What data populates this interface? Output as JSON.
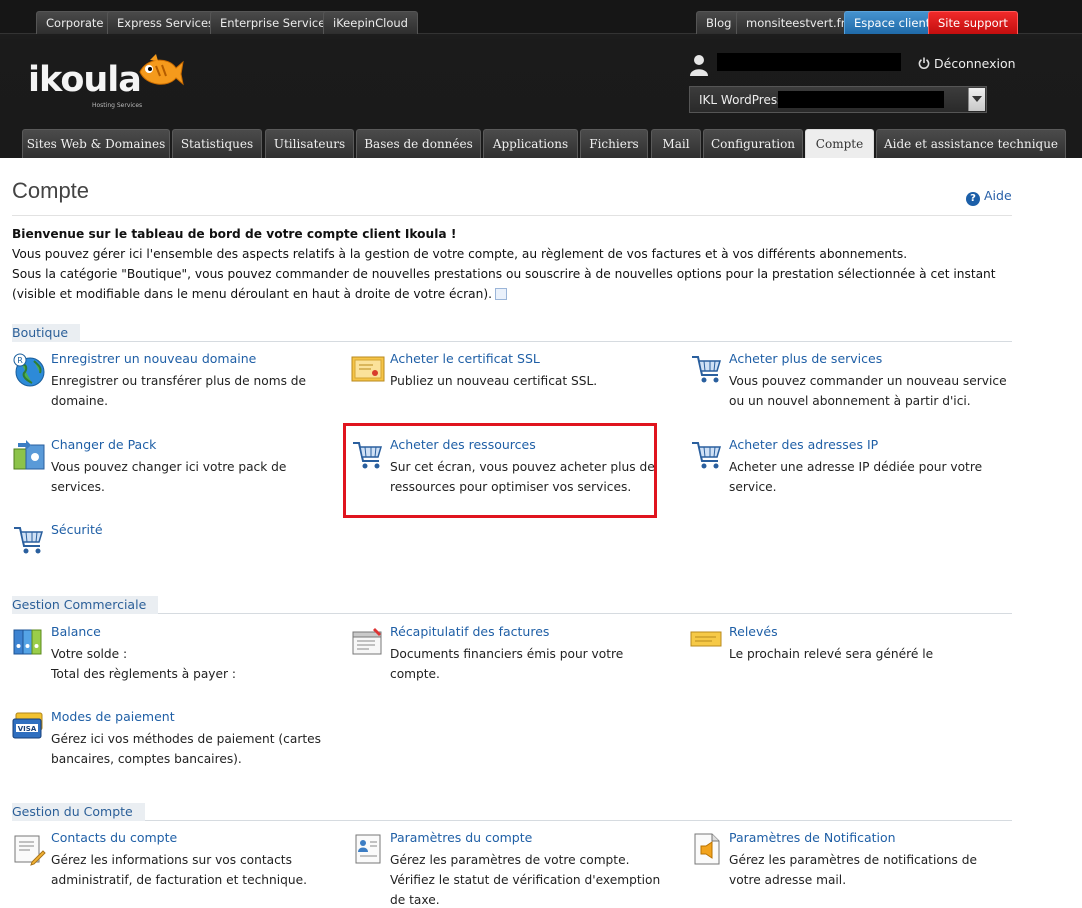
{
  "top_tabs": {
    "corporate": "Corporate",
    "express": "Express Services",
    "enterprise": "Enterprise Services",
    "ikeepin": "iKeepinCloud",
    "blog": "Blog",
    "site": "monsiteestvert.fr",
    "espace_client": "Espace client",
    "support": "Site support"
  },
  "logo": {
    "text": "ikoula",
    "tagline": "Hosting Services"
  },
  "header": {
    "logout": "Déconnexion",
    "pack_label": "IKL WordPress"
  },
  "main_tabs": [
    "Sites Web & Domaines",
    "Statistiques",
    "Utilisateurs",
    "Bases de données",
    "Applications",
    "Fichiers",
    "Mail",
    "Configuration",
    "Compte",
    "Aide et assistance technique"
  ],
  "page": {
    "title": "Compte",
    "help": "Aide",
    "intro_bold": "Bienvenue sur le tableau de bord de votre compte client Ikoula !",
    "intro_line2": "Vous pouvez gérer ici l'ensemble des aspects relatifs à la gestion de votre compte, au règlement de vos factures et à vos différents abonnements.",
    "intro_line3": "Sous la catégorie \"Boutique\", vous pouvez commander de nouvelles prestations ou souscrire à de nouvelles options pour la prestation sélectionnée à cet instant (visible et modifiable dans le menu déroulant en haut à droite de votre écran)."
  },
  "boutique": {
    "heading": "Boutique",
    "items": [
      {
        "title": "Enregistrer un nouveau domaine",
        "desc": "Enregistrer ou transférer plus de noms de domaine."
      },
      {
        "title": "Acheter le certificat SSL",
        "desc": "Publiez un nouveau certificat SSL."
      },
      {
        "title": "Acheter plus de services",
        "desc": "Vous pouvez commander un nouveau service ou un nouvel abonnement à partir d'ici."
      },
      {
        "title": "Changer de Pack",
        "desc": "Vous pouvez changer ici votre pack de services."
      },
      {
        "title": "Acheter des ressources",
        "desc": "Sur cet écran, vous pouvez acheter plus de ressources pour optimiser vos services."
      },
      {
        "title": "Acheter des adresses IP",
        "desc": "Acheter une adresse IP dédiée pour votre service."
      },
      {
        "title": "Sécurité",
        "desc": ""
      }
    ]
  },
  "commerciale": {
    "heading": "Gestion Commerciale",
    "items": [
      {
        "title": "Balance",
        "desc": "Votre solde :\nTotal des règlements à payer :"
      },
      {
        "title": "Récapitulatif des factures",
        "desc": "Documents financiers émis pour votre compte."
      },
      {
        "title": "Relevés",
        "desc": "Le prochain relevé sera généré le"
      },
      {
        "title": "Modes de paiement",
        "desc": "Gérez ici vos méthodes de paiement (cartes bancaires, comptes bancaires)."
      }
    ]
  },
  "compte": {
    "heading": "Gestion du Compte",
    "items": [
      {
        "title": "Contacts du compte",
        "desc": "Gérez les informations sur vos contacts administratif, de facturation et technique."
      },
      {
        "title": "Paramètres du compte",
        "desc": "Gérez les paramètres de votre compte. Vérifiez le statut de vérification d'exemption de taxe."
      },
      {
        "title": "Paramètres de Notification",
        "desc": "Gérez les paramètres de notifications de votre adresse mail."
      }
    ]
  },
  "colors": {
    "link": "#1f5fa6",
    "section": "#2b5f98",
    "highlight": "#e0141e",
    "espace_client": "#1f6aa8",
    "support": "#c30e0e"
  }
}
